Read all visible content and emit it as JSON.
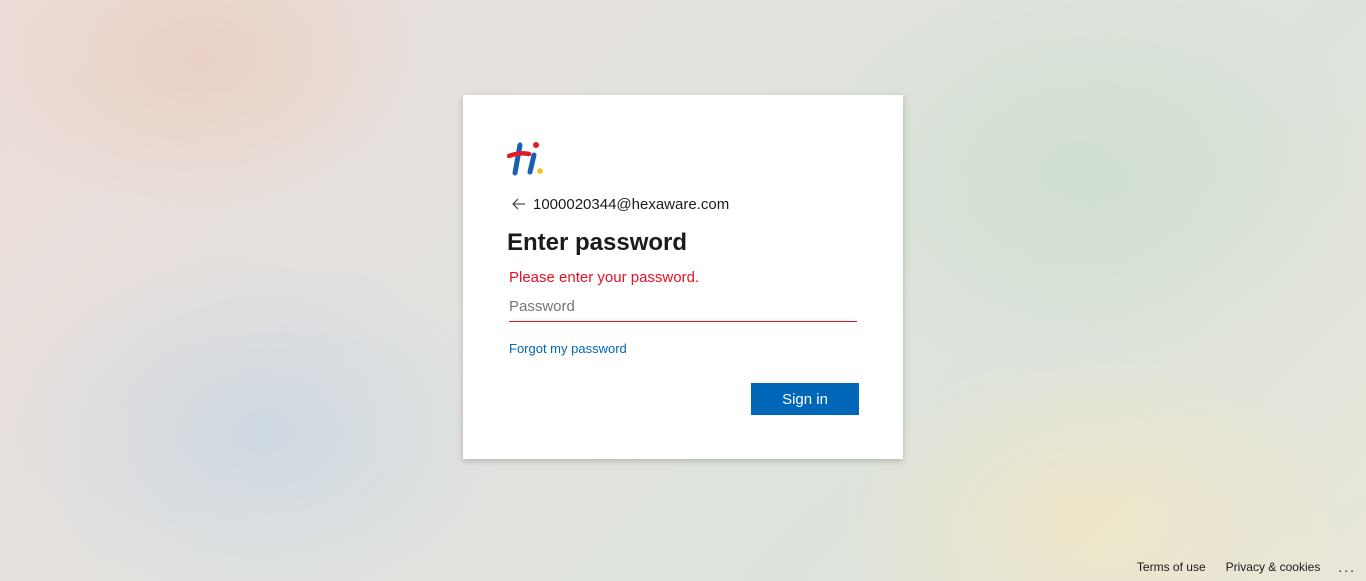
{
  "identity": {
    "back_icon": "arrow-left-icon",
    "email": "1000020344@hexaware.com"
  },
  "logo": {
    "name": "hexaware-hi-logo",
    "colors": {
      "blue": "#1a5fb4",
      "red": "#e01b24",
      "yellow": "#f5c211"
    }
  },
  "form": {
    "title": "Enter password",
    "error": "Please enter your password.",
    "password_value": "",
    "password_placeholder": "Password",
    "forgot_label": "Forgot my password",
    "signin_label": "Sign in"
  },
  "footer": {
    "terms_label": "Terms of use",
    "privacy_label": "Privacy & cookies",
    "more_label": "..."
  },
  "colors": {
    "accent": "#0067b8",
    "error": "#e81123"
  }
}
